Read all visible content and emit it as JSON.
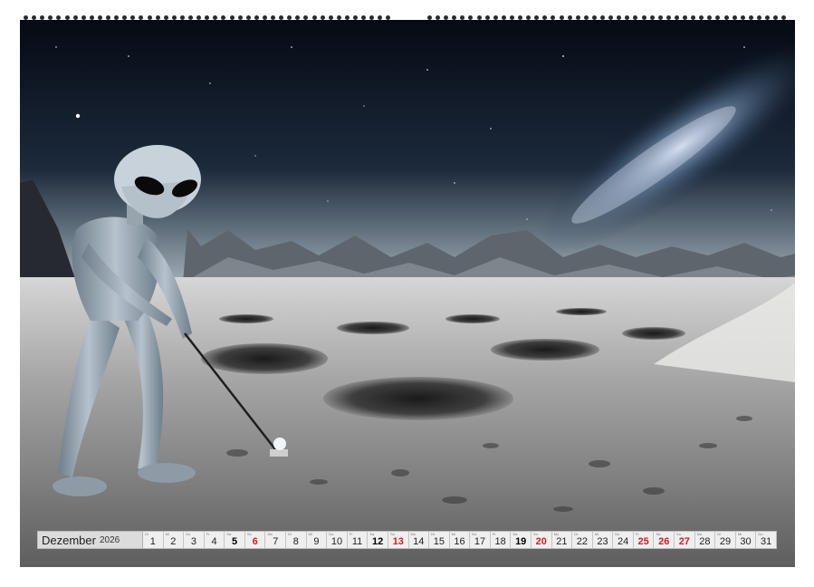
{
  "calendar": {
    "month": "Dezember",
    "year": "2026",
    "days": [
      {
        "num": "1",
        "abbr": "Di",
        "type": "normal"
      },
      {
        "num": "2",
        "abbr": "Mi",
        "type": "normal"
      },
      {
        "num": "3",
        "abbr": "Do",
        "type": "normal"
      },
      {
        "num": "4",
        "abbr": "Fr",
        "type": "normal"
      },
      {
        "num": "5",
        "abbr": "Sa",
        "type": "dark"
      },
      {
        "num": "6",
        "abbr": "So",
        "type": "red"
      },
      {
        "num": "7",
        "abbr": "Mo",
        "type": "normal"
      },
      {
        "num": "8",
        "abbr": "Di",
        "type": "normal"
      },
      {
        "num": "9",
        "abbr": "Mi",
        "type": "normal"
      },
      {
        "num": "10",
        "abbr": "Do",
        "type": "normal"
      },
      {
        "num": "11",
        "abbr": "Fr",
        "type": "normal"
      },
      {
        "num": "12",
        "abbr": "Sa",
        "type": "dark"
      },
      {
        "num": "13",
        "abbr": "So",
        "type": "red"
      },
      {
        "num": "14",
        "abbr": "Mo",
        "type": "normal"
      },
      {
        "num": "15",
        "abbr": "Di",
        "type": "normal"
      },
      {
        "num": "16",
        "abbr": "Mi",
        "type": "normal"
      },
      {
        "num": "17",
        "abbr": "Do",
        "type": "normal"
      },
      {
        "num": "18",
        "abbr": "Fr",
        "type": "normal"
      },
      {
        "num": "19",
        "abbr": "Sa",
        "type": "dark"
      },
      {
        "num": "20",
        "abbr": "So",
        "type": "red"
      },
      {
        "num": "21",
        "abbr": "Mo",
        "type": "normal"
      },
      {
        "num": "22",
        "abbr": "Di",
        "type": "normal"
      },
      {
        "num": "23",
        "abbr": "Mi",
        "type": "normal"
      },
      {
        "num": "24",
        "abbr": "Do",
        "type": "normal"
      },
      {
        "num": "25",
        "abbr": "Fr",
        "type": "red"
      },
      {
        "num": "26",
        "abbr": "Sa",
        "type": "red"
      },
      {
        "num": "27",
        "abbr": "So",
        "type": "red"
      },
      {
        "num": "28",
        "abbr": "Mo",
        "type": "normal"
      },
      {
        "num": "29",
        "abbr": "Di",
        "type": "normal"
      },
      {
        "num": "30",
        "abbr": "Mi",
        "type": "normal"
      },
      {
        "num": "31",
        "abbr": "Do",
        "type": "normal"
      }
    ]
  },
  "colors": {
    "holiday_red": "#d21f1f",
    "sky_dark": "#0b1220",
    "moon_surface": "#9a9a9a"
  },
  "icons": {
    "binding": "spiral-binding-dots",
    "scene": "alien-golfer-on-moon"
  }
}
